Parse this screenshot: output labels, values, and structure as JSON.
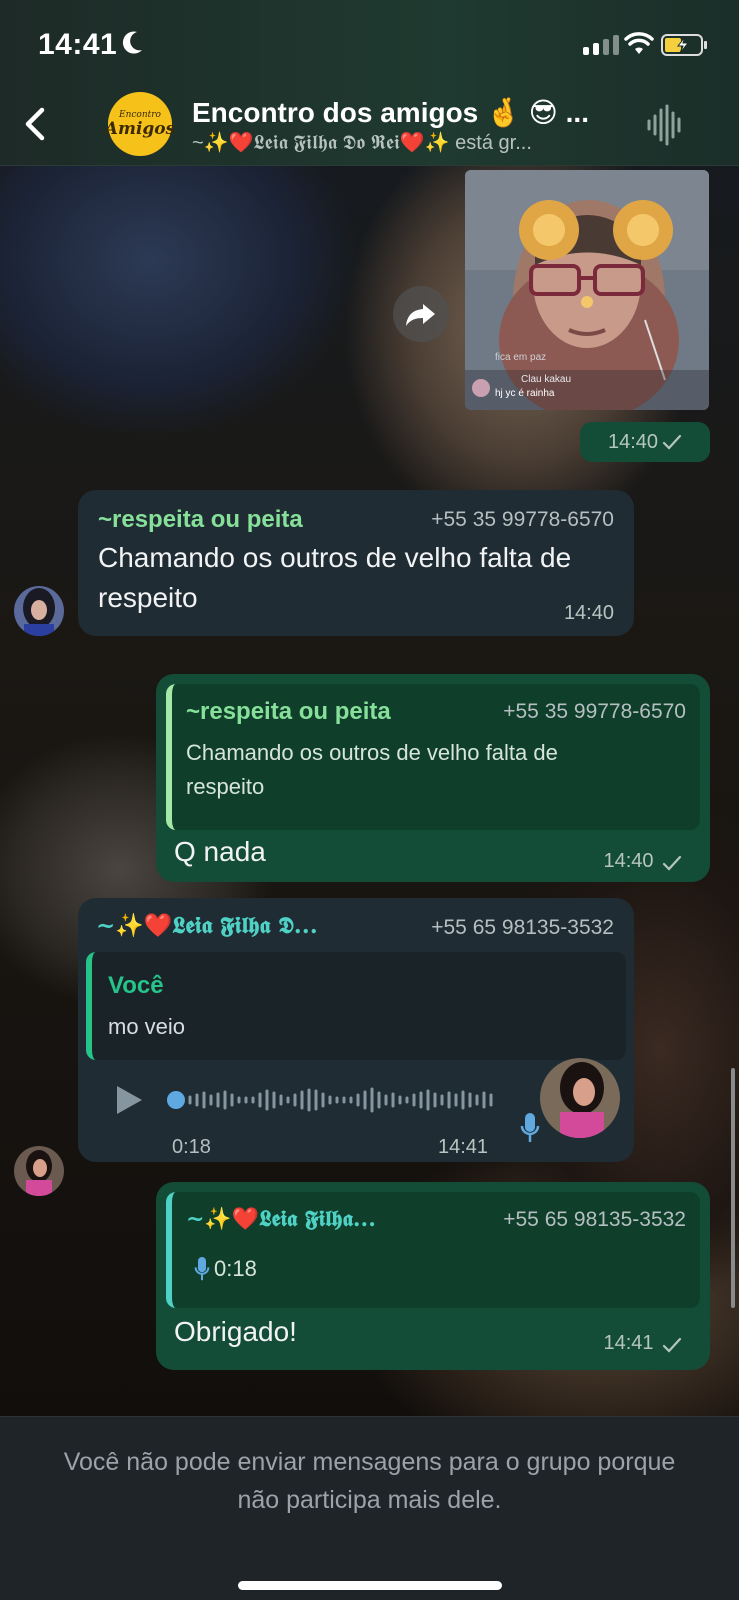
{
  "status_bar": {
    "time": "14:41"
  },
  "header": {
    "avatar_line1": "Encontro",
    "avatar_line2": "Amigos",
    "title": "Encontro dos amigos 🤞 😎 ...",
    "subtitle": "~✨❤️𝕷𝖊𝖎𝖆 𝕱𝖎𝖑𝖍𝖆 𝕯𝖔 𝕽𝖊𝖎❤️✨ está gr..."
  },
  "messages": {
    "m1": {
      "type": "image",
      "overlay_line1": "fica em paz",
      "overlay_line2": "Clau kakau",
      "overlay_line3": "hj yc é rainha",
      "time": "14:40"
    },
    "m2": {
      "sender": "~respeita ou peita",
      "phone": "+55 35 99778-6570",
      "text": "Chamando os outros de velho falta de respeito",
      "time": "14:40"
    },
    "m3": {
      "quote_sender": "~respeita ou peita",
      "quote_phone": "+55 35 99778-6570",
      "quote_text": "Chamando os outros de velho falta de respeito",
      "text": "Q nada",
      "time": "14:40"
    },
    "m4": {
      "sender": "~✨❤️𝕷𝖊𝖎𝖆 𝕱𝖎𝖑𝖍𝖆 𝕯...",
      "phone": "+55 65 98135-3532",
      "quote_sender": "Você",
      "quote_text": "mo veio",
      "audio_duration": "0:18",
      "time": "14:41"
    },
    "m5": {
      "quote_sender": "~✨❤️𝕷𝖊𝖎𝖆 𝕱𝖎𝖑𝖍𝖆...",
      "quote_phone": "+55 65 98135-3532",
      "quote_audio": "0:18",
      "text": "Obrigado!",
      "time": "14:41"
    }
  },
  "footer": {
    "notice": "Você não pode enviar mensagens para o grupo porque não participa mais dele."
  },
  "colors": {
    "outgoing_bubble": "#144d37",
    "incoming_bubble": "#202c33",
    "sender_green": "#86e09a",
    "sender_teal": "#4fd1c5"
  },
  "icons": [
    "moon-icon",
    "signal-icon",
    "wifi-icon",
    "battery-icon",
    "back-icon",
    "audio-wave-icon",
    "forward-icon",
    "check-icon",
    "play-icon",
    "mic-icon"
  ]
}
